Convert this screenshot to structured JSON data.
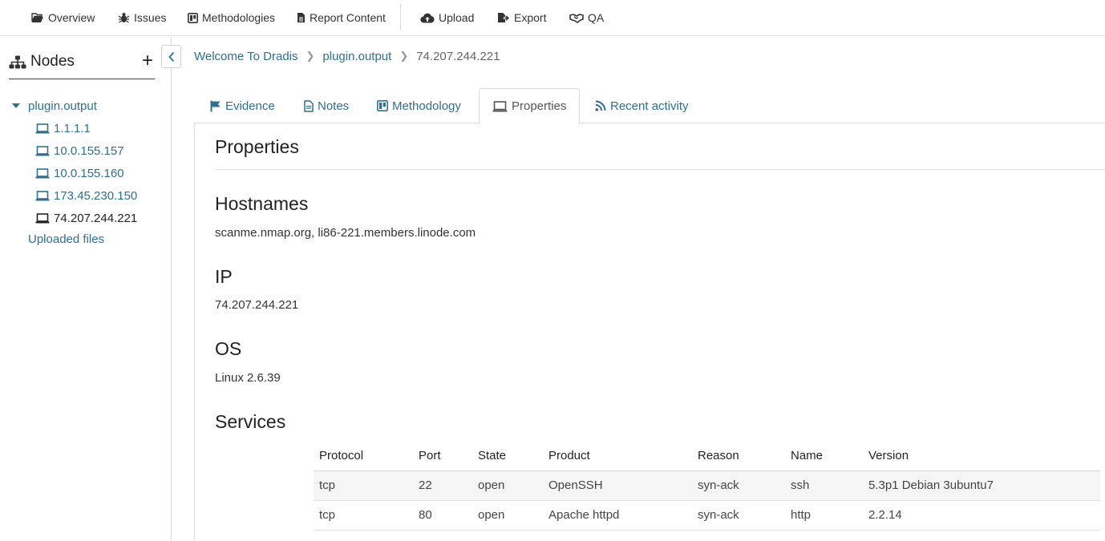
{
  "topnav": {
    "items": [
      {
        "label": "Overview",
        "icon": "folder-open-icon"
      },
      {
        "label": "Issues",
        "icon": "bug-icon"
      },
      {
        "label": "Methodologies",
        "icon": "board-icon"
      },
      {
        "label": "Report Content",
        "icon": "document-icon"
      },
      {
        "label": "Upload",
        "icon": "cloud-upload-icon"
      },
      {
        "label": "Export",
        "icon": "file-export-icon"
      },
      {
        "label": "QA",
        "icon": "handshake-icon"
      }
    ]
  },
  "sidebar": {
    "title": "Nodes",
    "add_label": "+",
    "root": {
      "label": "plugin.output"
    },
    "children": [
      {
        "label": "1.1.1.1"
      },
      {
        "label": "10.0.155.157"
      },
      {
        "label": "10.0.155.160"
      },
      {
        "label": "173.45.230.150"
      },
      {
        "label": "74.207.244.221"
      }
    ],
    "uploaded_label": "Uploaded files"
  },
  "breadcrumb": {
    "items": [
      "Welcome To Dradis",
      "plugin.output",
      "74.207.244.221"
    ]
  },
  "tabs": [
    {
      "label": "Evidence",
      "icon": "flag-icon"
    },
    {
      "label": "Notes",
      "icon": "note-icon"
    },
    {
      "label": "Methodology",
      "icon": "board-icon"
    },
    {
      "label": "Properties",
      "icon": "laptop-icon"
    },
    {
      "label": "Recent activity",
      "icon": "rss-icon"
    }
  ],
  "properties": {
    "title": "Properties",
    "hostnames": {
      "heading": "Hostnames",
      "value": "scanme.nmap.org, li86-221.members.linode.com"
    },
    "ip": {
      "heading": "IP",
      "value": "74.207.244.221"
    },
    "os": {
      "heading": "OS",
      "value": "Linux 2.6.39"
    },
    "services": {
      "heading": "Services",
      "columns": [
        "Protocol",
        "Port",
        "State",
        "Product",
        "Reason",
        "Name",
        "Version"
      ],
      "rows": [
        [
          "tcp",
          "22",
          "open",
          "OpenSSH",
          "syn-ack",
          "ssh",
          "5.3p1 Debian 3ubuntu7"
        ],
        [
          "tcp",
          "80",
          "open",
          "Apache httpd",
          "syn-ack",
          "http",
          "2.2.14"
        ]
      ]
    }
  },
  "colors": {
    "link": "#2f6f8f",
    "text": "#333333",
    "border": "#dcdcdc"
  }
}
